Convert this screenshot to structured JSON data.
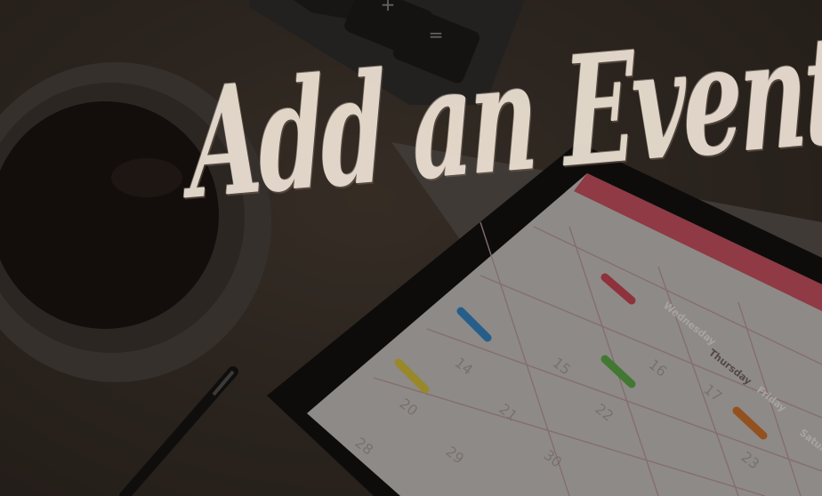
{
  "title": "Add an Event",
  "calendar": {
    "day_labels": [
      "Wednesday",
      "Thursday",
      "Friday",
      "Saturday"
    ],
    "dates": [
      "14",
      "15",
      "16",
      "17",
      "20",
      "21",
      "22",
      "23",
      "28",
      "29",
      "30"
    ]
  },
  "calculator": {
    "keys": [
      "+",
      "="
    ]
  },
  "colors": {
    "accent_red": "#d9475a",
    "marker_yellow": "#e8d23a",
    "marker_green": "#5fb84a",
    "marker_blue": "#2f8fd8",
    "marker_orange": "#e07a2a",
    "title_fill": "#efe4d6"
  }
}
